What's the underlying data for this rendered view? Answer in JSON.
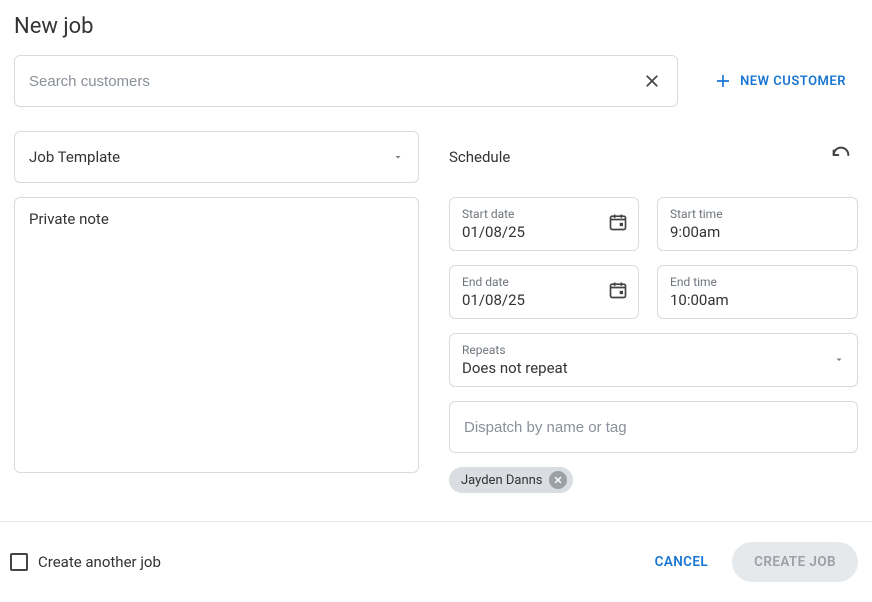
{
  "page_title": "New job",
  "search": {
    "placeholder": "Search customers"
  },
  "new_customer_label": "NEW CUSTOMER",
  "job_template": {
    "value": "Job Template"
  },
  "private_note": {
    "placeholder": "Private note"
  },
  "schedule": {
    "title": "Schedule",
    "start_date": {
      "label": "Start date",
      "value": "01/08/25"
    },
    "start_time": {
      "label": "Start time",
      "value": "9:00am"
    },
    "end_date": {
      "label": "End date",
      "value": "01/08/25"
    },
    "end_time": {
      "label": "End time",
      "value": "10:00am"
    },
    "repeats": {
      "label": "Repeats",
      "value": "Does not repeat"
    },
    "dispatch_placeholder": "Dispatch by name or tag",
    "assignees": [
      {
        "name": "Jayden Danns"
      }
    ]
  },
  "footer": {
    "create_another_label": "Create another job",
    "cancel_label": "CANCEL",
    "create_label": "CREATE JOB"
  }
}
